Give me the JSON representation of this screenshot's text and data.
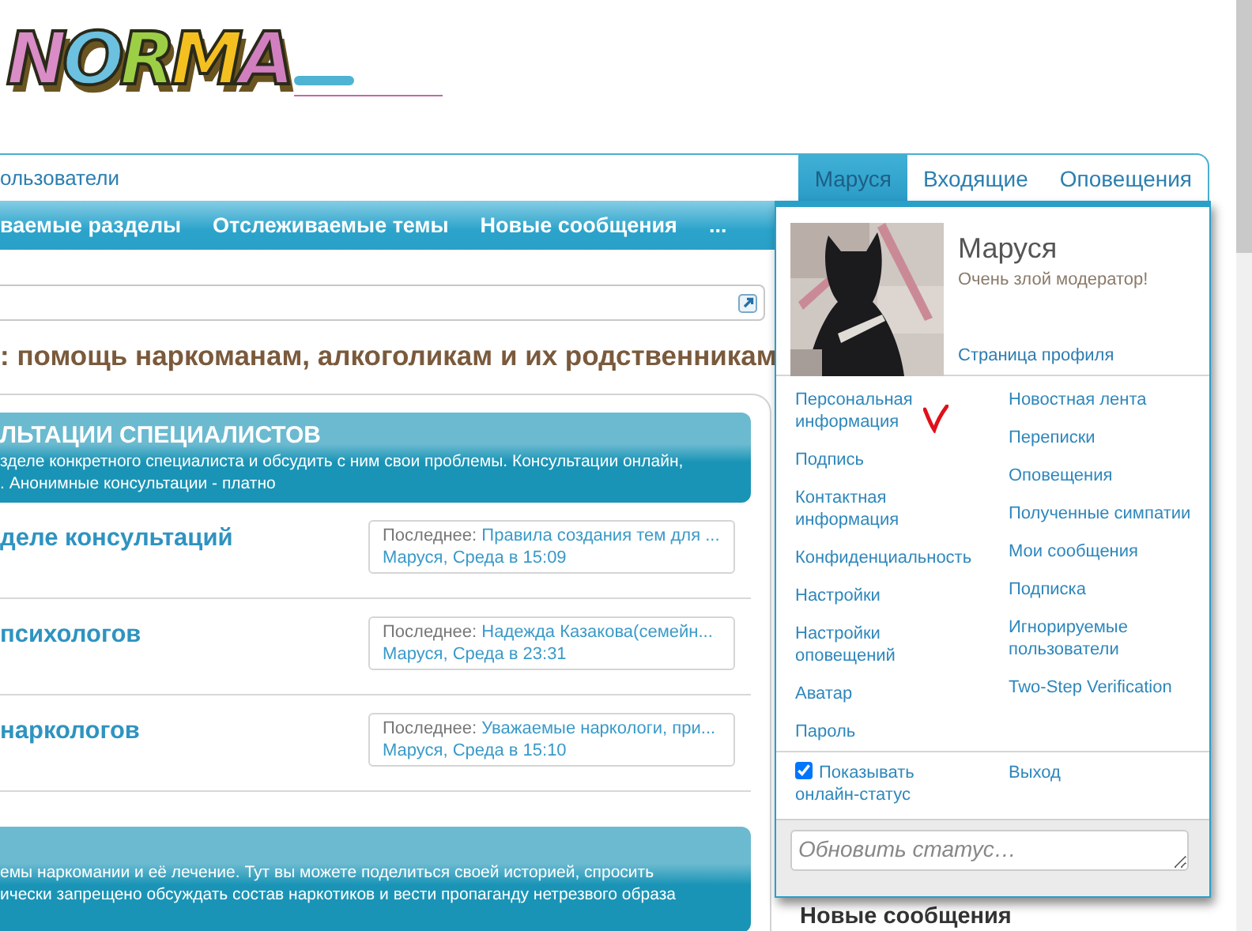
{
  "logo": {
    "text": "NORMA"
  },
  "top_nav": {
    "label": "ользователи"
  },
  "user_tabs": [
    {
      "label": "Маруся",
      "selected": true
    },
    {
      "label": "Входящие",
      "selected": false
    },
    {
      "label": "Оповещения",
      "selected": false
    }
  ],
  "sub_nav": [
    "ваемые разделы",
    "Отслеживаемые темы",
    "Новые сообщения",
    "..."
  ],
  "page_title": ": помощь наркоманам, алкоголикам и их родственникам",
  "categories": [
    {
      "title": "ЛЬТАЦИИ СПЕЦИАЛИСТОВ",
      "description_lines": [
        "зделе конкретного специалиста и обсудить с ним свои проблемы. Консультации онлайн,",
        ". Анонимные консультации - платно"
      ],
      "forums": [
        {
          "title": "деле консультаций",
          "last_label": "Последнее:",
          "last_thread": "Правила создания тем для ...",
          "last_meta": "Маруся, Среда в 15:09"
        },
        {
          "title": "психологов",
          "last_label": "Последнее:",
          "last_thread": "Надежда Казакова(семейн...",
          "last_meta": "Маруся, Среда в 23:31"
        },
        {
          "title": "наркологов",
          "last_label": "Последнее:",
          "last_thread": "Уважаемые наркологи, при...",
          "last_meta": "Маруся, Среда в 15:10"
        }
      ]
    },
    {
      "description_lines": [
        "емы наркомании и её лечение. Тут вы можете поделиться своей историей, спросить",
        "ически запрещено обсуждать состав наркотиков и вести пропаганду нетрезвого образа"
      ]
    }
  ],
  "user_menu": {
    "name": "Маруся",
    "subtitle": "Очень злой модератор!",
    "profile_link": "Страница профиля",
    "left_links": [
      "Персональная информация",
      "Подпись",
      "Контактная информация",
      "Конфиденциальность",
      "Настройки",
      "Настройки оповещений",
      "Аватар",
      "Пароль"
    ],
    "right_links": [
      "Новостная лента",
      "Переписки",
      "Оповещения",
      "Полученные симпатии",
      "Мои сообщения",
      "Подписка",
      "Игнорируемые пользователи",
      "Two-Step Verification"
    ],
    "show_online": {
      "label": "Показывать онлайн-статус",
      "checked": true
    },
    "logout": "Выход",
    "status": {
      "placeholder": "Обновить статус…"
    }
  },
  "sidebar": {
    "heading": "Новые сообщения"
  }
}
